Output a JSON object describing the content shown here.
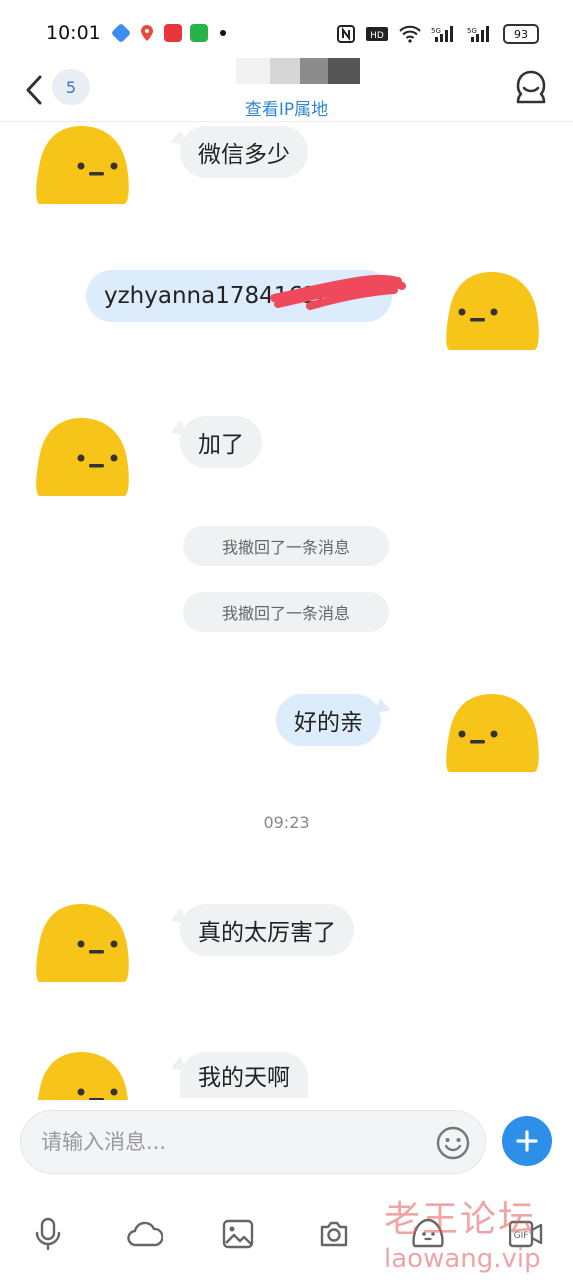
{
  "status_bar": {
    "time": "10:01",
    "battery": "93",
    "indicators": [
      "nfc-icon",
      "hd-icon",
      "wifi-icon",
      "5g-signal-icon",
      "5g-signal-icon"
    ]
  },
  "header": {
    "unread_count": "5",
    "ip_link": "查看IP属地"
  },
  "messages": [
    {
      "side": "left",
      "text": "微信多少"
    },
    {
      "side": "right",
      "text": "yzhyanna17841628"
    },
    {
      "side": "left",
      "text": "加了"
    },
    {
      "side": "system",
      "text": "我撤回了一条消息"
    },
    {
      "side": "system",
      "text": "我撤回了一条消息"
    },
    {
      "side": "right",
      "text": "好的亲"
    },
    {
      "side": "timestamp",
      "text": "09:23"
    },
    {
      "side": "left",
      "text": "真的太厉害了"
    },
    {
      "side": "left",
      "text": "我的天啊"
    }
  ],
  "input": {
    "placeholder": "请输入消息..."
  },
  "toolbar": [
    "mic-icon",
    "cloud-icon",
    "image-icon",
    "camera-icon",
    "sticker-icon",
    "gif-icon"
  ],
  "watermark": {
    "cn": "老王论坛",
    "en": "laowang.vip"
  },
  "colors": {
    "accent": "#2d8fe8",
    "bubble_left": "#f0f1f3",
    "bubble_right": "#dcecfb",
    "avatar_yellow": "#f7c51a",
    "link": "#2f86d6"
  }
}
